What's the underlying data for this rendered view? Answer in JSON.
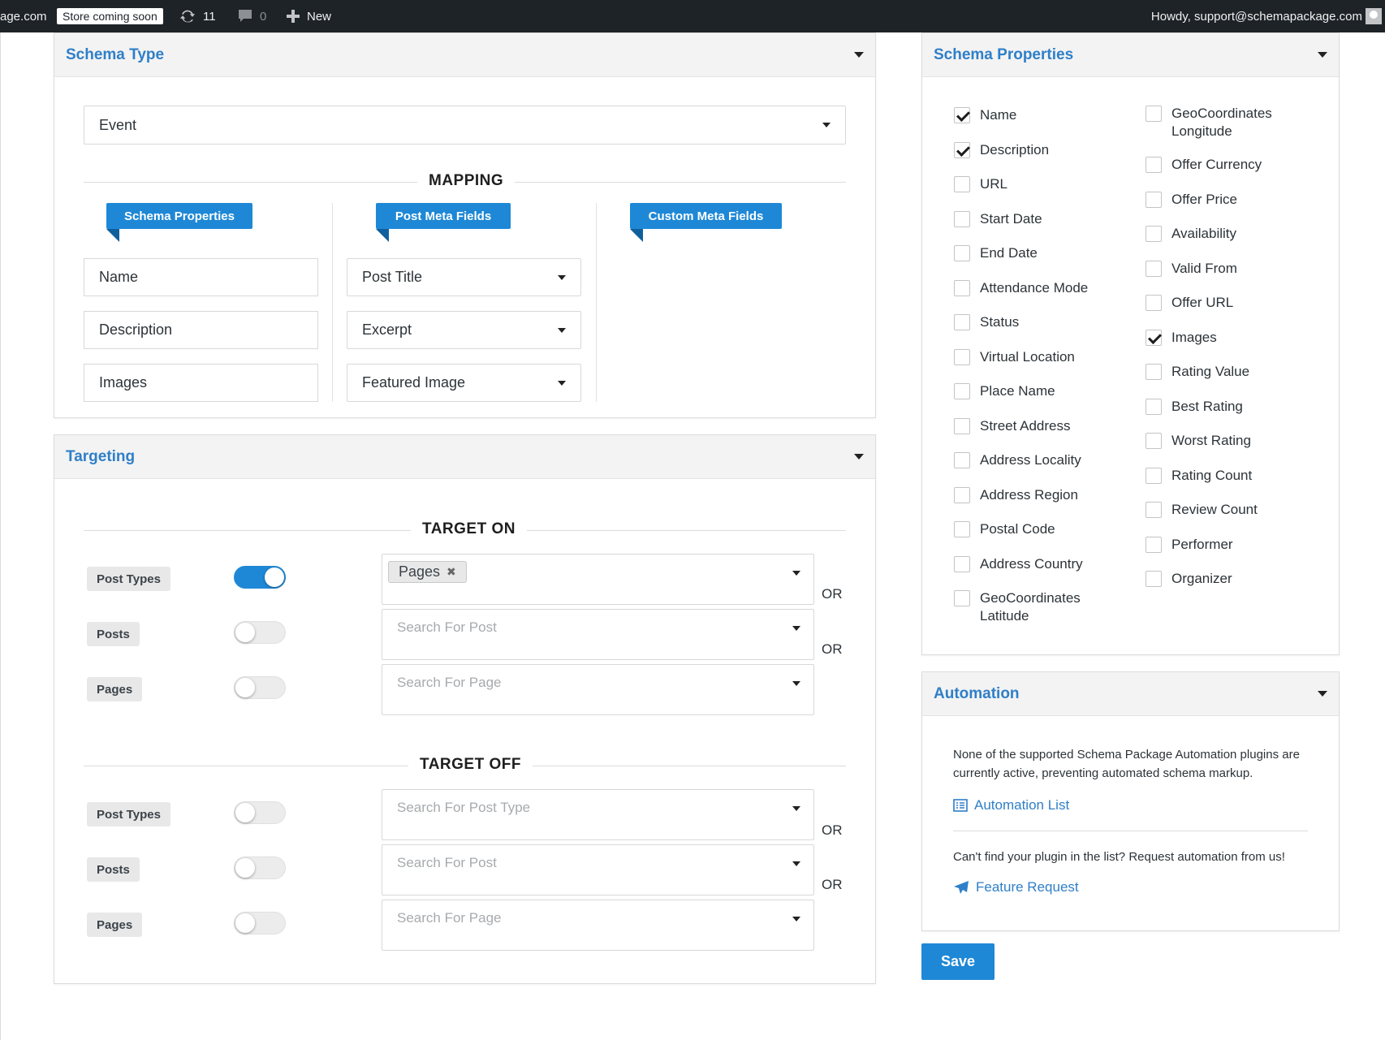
{
  "adminbar": {
    "site": "age.com",
    "store_badge": "Store coming soon",
    "updates_count": "11",
    "comments_count": "0",
    "new_label": "New",
    "howdy": "Howdy, support@schemapackage.com"
  },
  "schema_type": {
    "title": "Schema Type",
    "selected": "Event",
    "mapping_label": "MAPPING",
    "ribbons": {
      "schema_properties": "Schema Properties",
      "post_meta_fields": "Post Meta Fields",
      "custom_meta_fields": "Custom Meta Fields"
    },
    "rows": [
      {
        "property": "Name",
        "meta": "Post Title"
      },
      {
        "property": "Description",
        "meta": "Excerpt"
      },
      {
        "property": "Images",
        "meta": "Featured Image"
      }
    ]
  },
  "targeting": {
    "title": "Targeting",
    "target_on_label": "TARGET ON",
    "target_off_label": "TARGET OFF",
    "or_label": "OR",
    "target_on": [
      {
        "label": "Post Types",
        "enabled": true,
        "chip": "Pages",
        "placeholder": ""
      },
      {
        "label": "Posts",
        "enabled": false,
        "placeholder": "Search For Post"
      },
      {
        "label": "Pages",
        "enabled": false,
        "placeholder": "Search For Page"
      }
    ],
    "target_off": [
      {
        "label": "Post Types",
        "enabled": false,
        "placeholder": "Search For Post Type"
      },
      {
        "label": "Posts",
        "enabled": false,
        "placeholder": "Search For Post"
      },
      {
        "label": "Pages",
        "enabled": false,
        "placeholder": "Search For Page"
      }
    ]
  },
  "schema_properties": {
    "title": "Schema Properties",
    "left": [
      {
        "label": "Name",
        "checked": true
      },
      {
        "label": "Description",
        "checked": true
      },
      {
        "label": "URL",
        "checked": false
      },
      {
        "label": "Start Date",
        "checked": false
      },
      {
        "label": "End Date",
        "checked": false
      },
      {
        "label": "Attendance Mode",
        "checked": false
      },
      {
        "label": "Status",
        "checked": false
      },
      {
        "label": "Virtual Location",
        "checked": false
      },
      {
        "label": "Place Name",
        "checked": false
      },
      {
        "label": "Street Address",
        "checked": false
      },
      {
        "label": "Address Locality",
        "checked": false
      },
      {
        "label": "Address Region",
        "checked": false
      },
      {
        "label": "Postal Code",
        "checked": false
      },
      {
        "label": "Address Country",
        "checked": false
      },
      {
        "label": "GeoCoordinates Latitude",
        "checked": false
      }
    ],
    "right": [
      {
        "label": "GeoCoordinates Longitude",
        "checked": false
      },
      {
        "label": "Offer Currency",
        "checked": false
      },
      {
        "label": "Offer Price",
        "checked": false
      },
      {
        "label": "Availability",
        "checked": false
      },
      {
        "label": "Valid From",
        "checked": false
      },
      {
        "label": "Offer URL",
        "checked": false
      },
      {
        "label": "Images",
        "checked": true
      },
      {
        "label": "Rating Value",
        "checked": false
      },
      {
        "label": "Best Rating",
        "checked": false
      },
      {
        "label": "Worst Rating",
        "checked": false
      },
      {
        "label": "Rating Count",
        "checked": false
      },
      {
        "label": "Review Count",
        "checked": false
      },
      {
        "label": "Performer",
        "checked": false
      },
      {
        "label": "Organizer",
        "checked": false
      }
    ]
  },
  "automation": {
    "title": "Automation",
    "notice": "None of the supported Schema Package Automation plugins are currently active, preventing automated schema markup.",
    "list_link": "Automation List",
    "request_text": "Can't find your plugin in the list? Request automation from us!",
    "feature_link": "Feature Request"
  },
  "save_label": "Save",
  "colors": {
    "accent": "#1e88d6",
    "title_blue": "#2f7fc8",
    "adminbar": "#1d2327"
  }
}
